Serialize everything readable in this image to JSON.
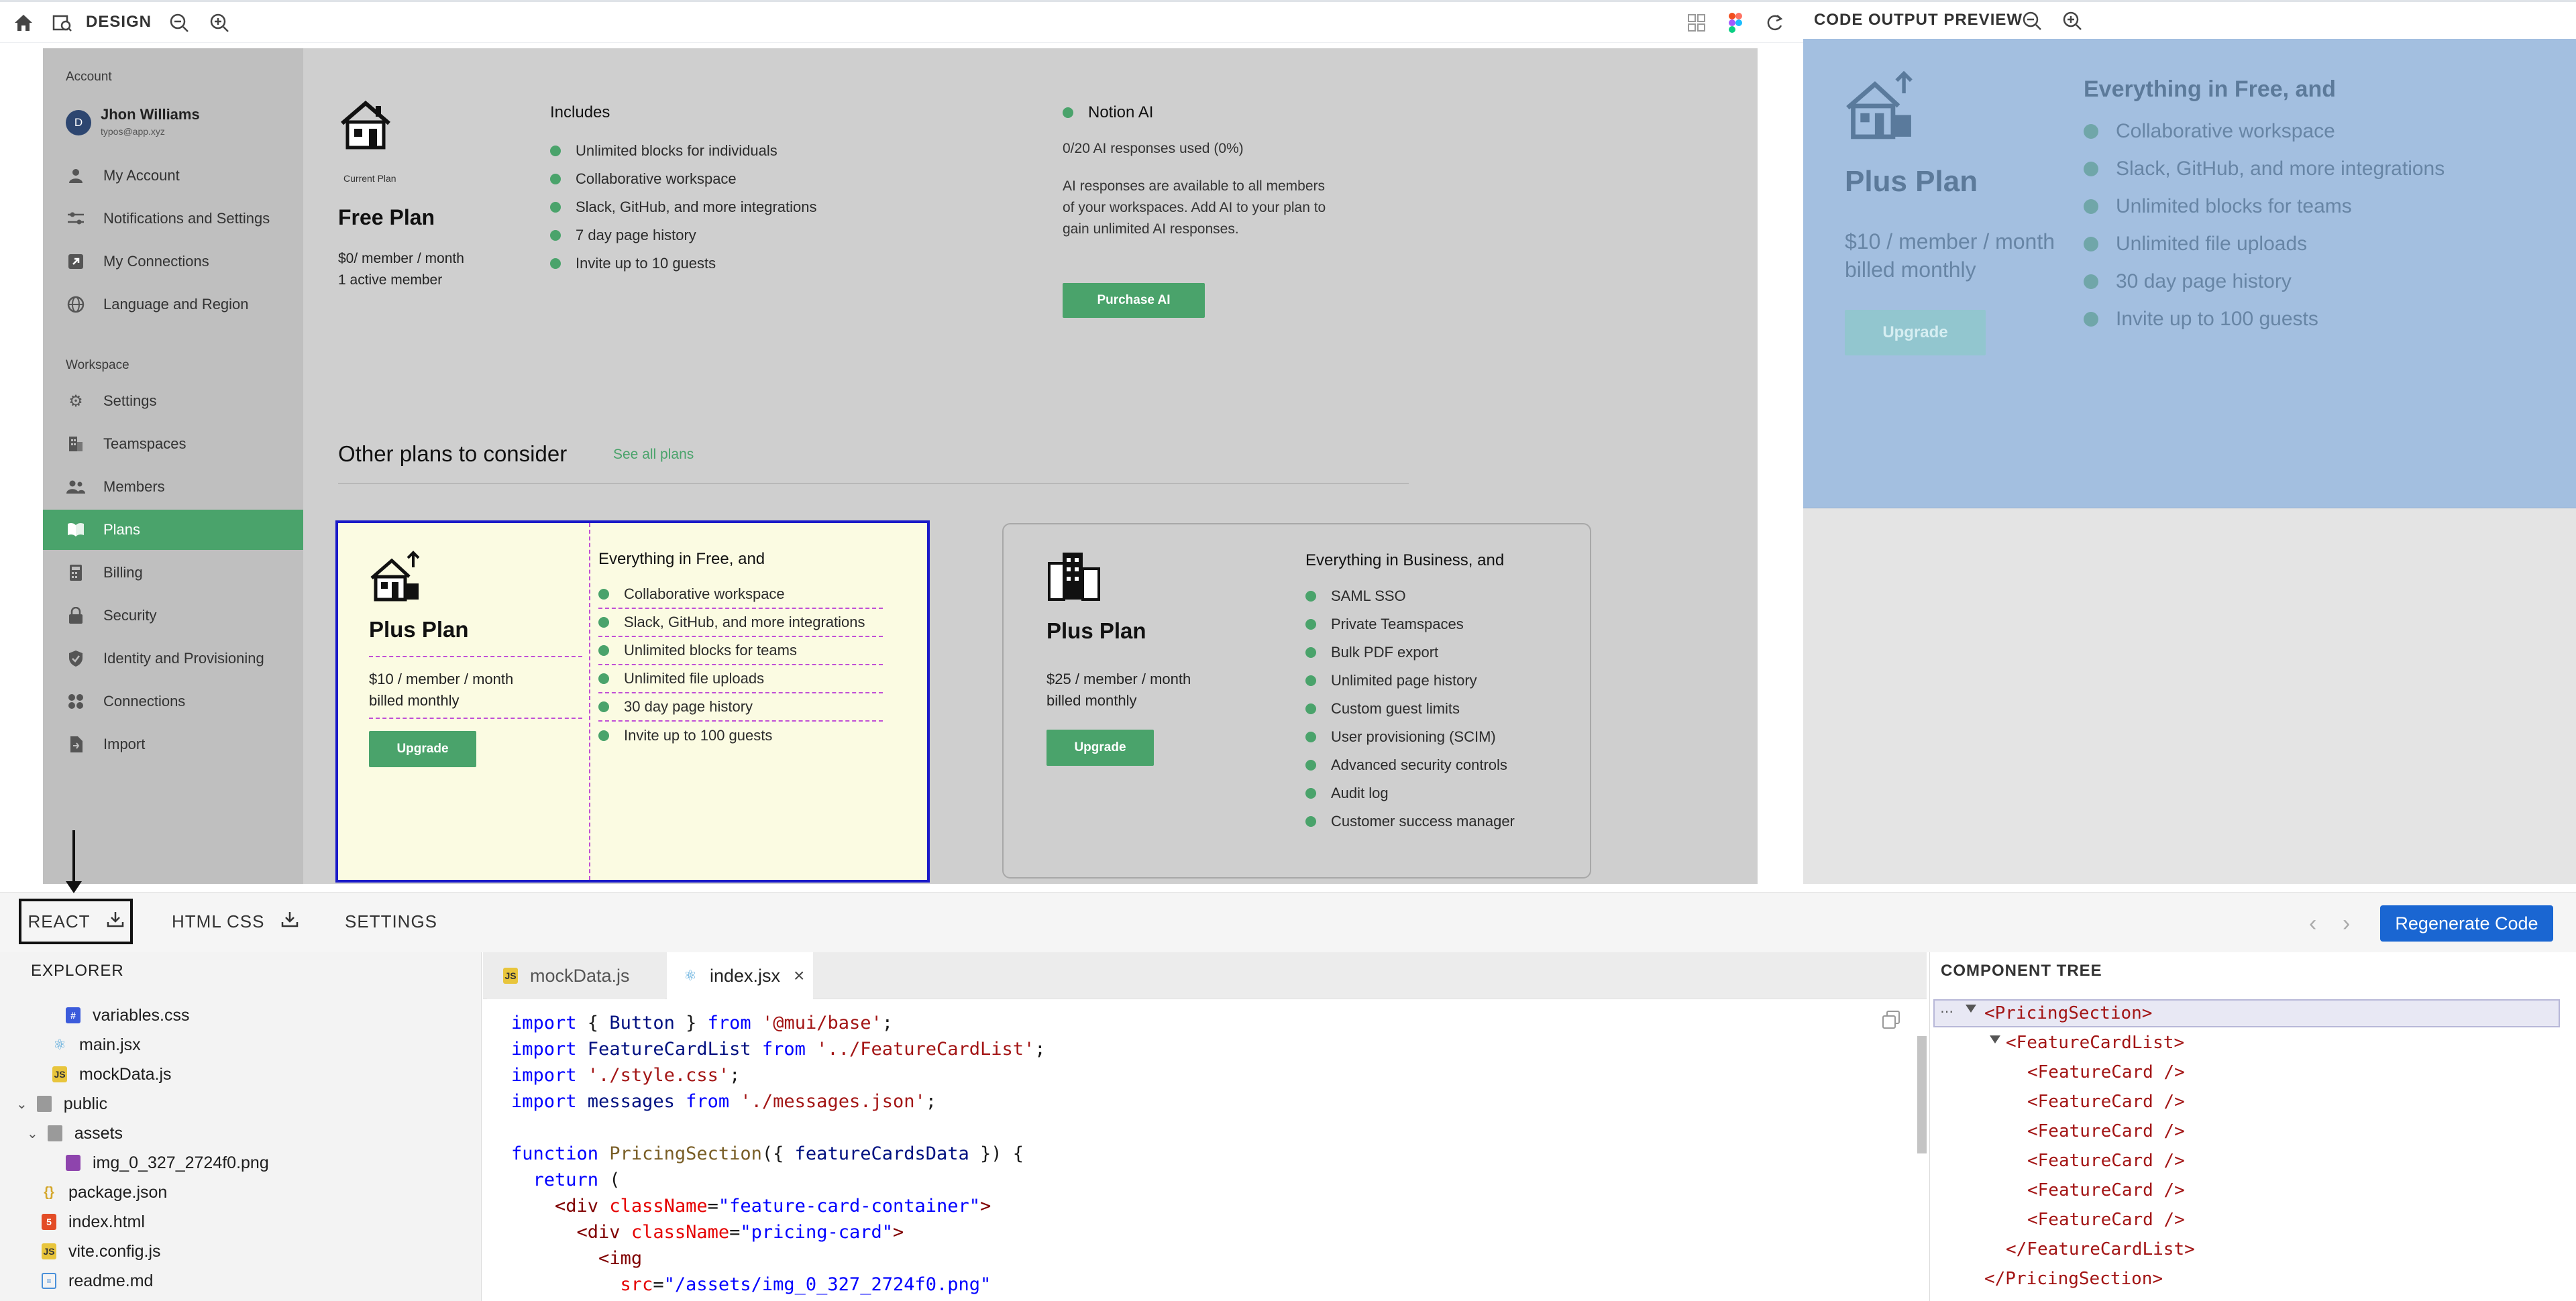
{
  "topbar": {
    "title": "DESIGN",
    "preview_title": "CODE OUTPUT PREVIEW"
  },
  "sidebar": {
    "account_label": "Account",
    "user": {
      "initial": "D",
      "name": "Jhon Williams",
      "email": "typos@app.xyz"
    },
    "account_items": [
      {
        "label": "My Account",
        "icon": "person-icon"
      },
      {
        "label": "Notifications and Settings",
        "icon": "sliders-icon"
      },
      {
        "label": "My Connections",
        "icon": "external-link-icon"
      },
      {
        "label": "Language and Region",
        "icon": "globe-icon"
      }
    ],
    "workspace_label": "Workspace",
    "workspace_items": [
      {
        "label": "Settings",
        "icon": "gear-icon"
      },
      {
        "label": "Teamspaces",
        "icon": "building-icon"
      },
      {
        "label": "Members",
        "icon": "people-icon"
      },
      {
        "label": "Plans",
        "icon": "book-icon",
        "active": true
      },
      {
        "label": "Billing",
        "icon": "calculator-icon"
      },
      {
        "label": "Security",
        "icon": "lock-icon"
      },
      {
        "label": "Identity and Provisioning",
        "icon": "shield-icon"
      },
      {
        "label": "Connections",
        "icon": "grid-icon"
      },
      {
        "label": "Import",
        "icon": "import-icon"
      }
    ]
  },
  "current_plan": {
    "caption": "Current Plan",
    "name": "Free Plan",
    "price": "$0/ member / month",
    "members": "1 active member",
    "includes_title": "Includes",
    "includes": [
      "Unlimited blocks for individuals",
      "Collaborative workspace",
      "Slack, GitHub, and more integrations",
      "7 day page history",
      "Invite up to 10 guests"
    ]
  },
  "notion_ai": {
    "title": "Notion AI",
    "usage": "0/20 AI responses used (0%)",
    "desc_1": "AI responses are available to all members",
    "desc_2": "of your workspaces. Add AI to your plan to",
    "desc_3": "gain unlimited AI responses.",
    "button": "Purchase AI"
  },
  "other_plans": {
    "title": "Other plans to consider",
    "link": "See all plans"
  },
  "plus_card": {
    "name": "Plus Plan",
    "price_1": "$10 / member / month",
    "price_2": "billed monthly",
    "button": "Upgrade",
    "features_title": "Everything in Free, and",
    "features": [
      "Collaborative workspace",
      "Slack, GitHub, and more integrations",
      "Unlimited blocks for teams",
      "Unlimited file uploads",
      "30 day page history",
      "Invite up to 100 guests"
    ]
  },
  "business_card": {
    "name": "Plus Plan",
    "price_1": "$25 / member / month",
    "price_2": "billed monthly",
    "button": "Upgrade",
    "features_title": "Everything in Business, and",
    "features": [
      "SAML SSO",
      "Private Teamspaces",
      "Bulk PDF export",
      "Unlimited page history",
      "Custom guest limits",
      "User provisioning (SCIM)",
      "Advanced security controls",
      "Audit log",
      "Customer success manager"
    ]
  },
  "preview": {
    "name": "Plus Plan",
    "price_1": "$10 / member / month",
    "price_2": "billed monthly",
    "button": "Upgrade",
    "features_title": "Everything in Free, and",
    "features": [
      "Collaborative workspace",
      "Slack, GitHub, and more integrations",
      "Unlimited blocks for teams",
      "Unlimited file uploads",
      "30 day page history",
      "Invite up to 100 guests"
    ]
  },
  "tabs": {
    "react": "REACT",
    "html_css": "HTML CSS",
    "settings": "SETTINGS",
    "regenerate": "Regenerate Code"
  },
  "explorer": {
    "title": "EXPLORER",
    "files": [
      {
        "label": "variables.css",
        "type": "css"
      },
      {
        "label": "main.jsx",
        "type": "react"
      },
      {
        "label": "mockData.js",
        "type": "js"
      },
      {
        "label": "public",
        "type": "folder"
      },
      {
        "label": "assets",
        "type": "folder"
      },
      {
        "label": "img_0_327_2724f0.png",
        "type": "image"
      },
      {
        "label": "package.json",
        "type": "json"
      },
      {
        "label": "index.html",
        "type": "html"
      },
      {
        "label": "vite.config.js",
        "type": "js"
      },
      {
        "label": "readme.md",
        "type": "md"
      }
    ]
  },
  "editor": {
    "tab_1": "mockData.js",
    "tab_2": "index.jsx",
    "code": {
      "l1a": "import",
      "l1b": " { ",
      "l1c": "Button",
      "l1d": " } ",
      "l1e": "from",
      "l1f": " '@mui/base'",
      "l1g": ";",
      "l2a": "import",
      "l2b": " FeatureCardList ",
      "l2c": "from",
      "l2d": " '../FeatureCardList'",
      "l2e": ";",
      "l3a": "import",
      "l3b": " './style.css'",
      "l3c": ";",
      "l4a": "import",
      "l4b": " messages ",
      "l4c": "from",
      "l4d": " './messages.json'",
      "l4e": ";",
      "l6a": "function",
      "l6b": " PricingSection",
      "l6c": "({ ",
      "l6d": "featureCardsData",
      "l6e": " }) {",
      "l7a": "  return",
      "l7b": " (",
      "l8a": "    <",
      "l8b": "div",
      "l8c": " className",
      "l8d": "=",
      "l8e": "\"feature-card-container\"",
      "l8f": ">",
      "l9a": "      <",
      "l9b": "div",
      "l9c": " className",
      "l9d": "=",
      "l9e": "\"pricing-card\"",
      "l9f": ">",
      "l10a": "        <",
      "l10b": "img",
      "l11a": "          src",
      "l11b": "=",
      "l11c": "\"/assets/img_0_327_2724f0.png\""
    }
  },
  "component_tree": {
    "title": "COMPONENT TREE",
    "rows": [
      "<PricingSection>",
      "<FeatureCardList>",
      "<FeatureCard />",
      "<FeatureCard />",
      "<FeatureCard />",
      "<FeatureCard />",
      "<FeatureCard />",
      "<FeatureCard />",
      "</FeatureCardList>",
      "</PricingSection>"
    ]
  },
  "colors": {
    "accent_green": "#4aa36b",
    "selection_blue": "#1a1ac8",
    "primary_button": "#1a66d2",
    "preview_bg": "#a3bfe0"
  }
}
